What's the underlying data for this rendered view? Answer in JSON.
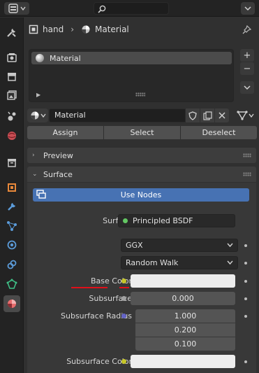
{
  "header": {
    "search": {
      "placeholder": ""
    }
  },
  "breadcrumb": {
    "object": "hand",
    "material": "Material"
  },
  "material_slots": [
    {
      "name": "Material"
    }
  ],
  "material": {
    "name": "Material"
  },
  "slot_actions": {
    "assign": "Assign",
    "select": "Select",
    "deselect": "Deselect"
  },
  "panels": {
    "preview": "Preview",
    "surface": "Surface"
  },
  "surface": {
    "use_nodes": "Use Nodes",
    "surface_label": "Surface",
    "surface_value": "Principled BSDF",
    "distribution": "GGX",
    "subsurface_method": "Random Walk",
    "base_color_label": "Base Color",
    "subsurface_label": "Subsurface",
    "subsurface_value": "0.000",
    "subsurface_radius_label": "Subsurface Radius",
    "subsurface_radius": [
      "1.000",
      "0.200",
      "0.100"
    ],
    "subsurface_color_label": "Subsurface Color"
  },
  "colors": {
    "accent": "#4772b3",
    "annotation_red": "#e0101a",
    "socket_shader": "#63c763",
    "socket_color": "#c7c729",
    "socket_float": "#a1a1a1",
    "socket_vector": "#6363c7",
    "base_color_swatch": "#ededed",
    "subsurface_color_swatch": "#ededed"
  },
  "icons": {
    "tabs": [
      "tool-icon",
      "render-icon",
      "output-icon",
      "view-layer-icon",
      "scene-icon",
      "world-icon",
      "collection-icon",
      "object-icon",
      "modifier-icon",
      "particles-icon",
      "physics-icon",
      "constraints-icon",
      "object-data-icon",
      "material-icon"
    ]
  }
}
